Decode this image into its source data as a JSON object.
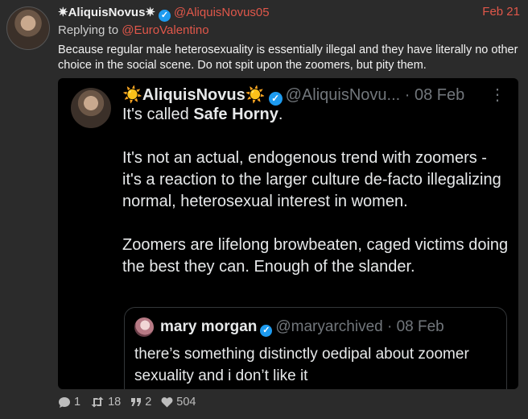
{
  "post": {
    "display_name": "✷AliquisNovus✷",
    "handle": "@AliquisNovus05",
    "date": "Feb 21",
    "replying_prefix": "Replying to",
    "replying_to": "@EuroValentino",
    "text": "Because regular male heterosexuality is essentially illegal and they have literally no other choice in the social scene. Do not spit upon the zoomers, but pity them."
  },
  "embed": {
    "display_name": "☀️AliquisNovus☀️",
    "handle": "@AliquisNovu...",
    "date": "· 08 Feb",
    "menu_glyph": "⋮",
    "line1_prefix": "It's called ",
    "line1_bold": "Safe Horny",
    "line1_suffix": ".",
    "paragraph2": "It's not an actual, endogenous trend with zoomers - it's a reaction to the larger culture de-facto illegalizing normal, heterosexual interest in women.",
    "paragraph3": "Zoomers are lifelong browbeaten, caged victims doing the best they can. Enough of the slander.",
    "quote": {
      "display_name": "mary morgan",
      "handle": "@maryarchived",
      "date": "· 08 Feb",
      "text": "there’s something distinctly oedipal about zoomer sexuality and i don’t like it"
    }
  },
  "actions": {
    "replies": "1",
    "reblogs": "18",
    "quotes": "2",
    "likes": "504"
  },
  "colors": {
    "accent": "#e0574a",
    "verified": "#1d9bf0",
    "background": "#2b2b2b"
  }
}
